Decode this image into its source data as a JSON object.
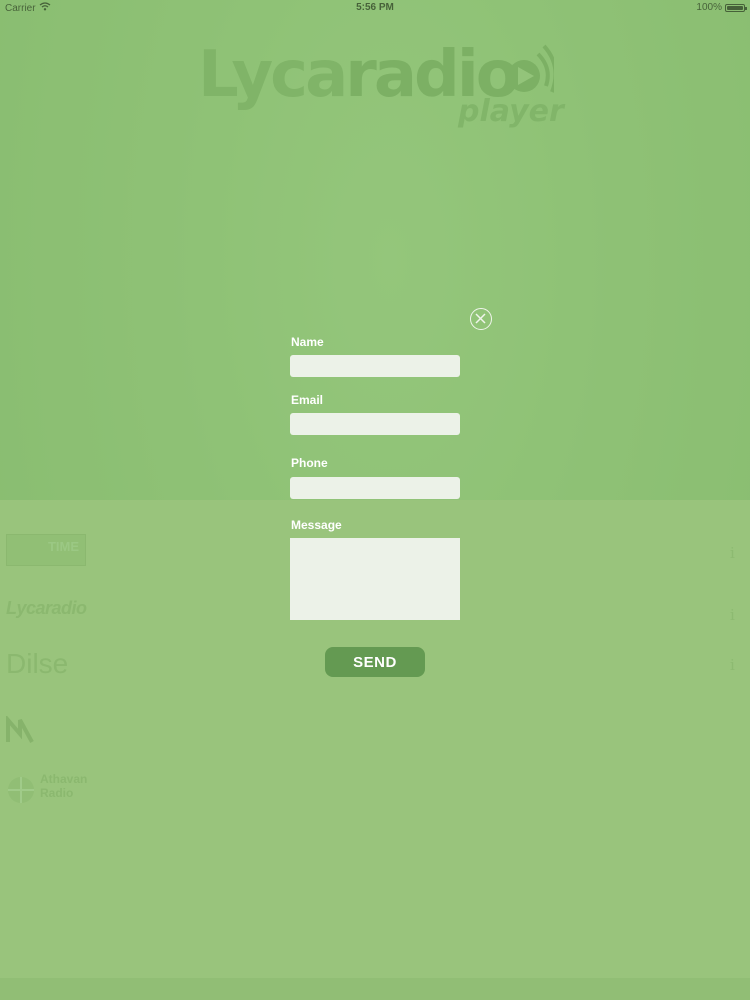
{
  "status_bar": {
    "carrier": "Carrier",
    "time": "5:56 PM",
    "battery": "100%",
    "battery_level": 1.0
  },
  "logo": {
    "word_lyca": "Lyca",
    "word_radio": "radio",
    "sub": "player"
  },
  "stations": [
    {
      "name": "TIME",
      "icon": "time-logo"
    },
    {
      "name": "Lycaradio",
      "icon": "lycaradio-logo"
    },
    {
      "name": "Dilse",
      "icon": "dilse-logo"
    },
    {
      "name": "",
      "icon": "radio-logo"
    },
    {
      "name": "Athavan Radio",
      "icon": "athavan-logo"
    }
  ],
  "form": {
    "name_label": "Name",
    "name_value": "",
    "email_label": "Email",
    "email_value": "",
    "phone_label": "Phone",
    "phone_value": "",
    "message_label": "Message",
    "message_value": "",
    "send_label": "SEND"
  },
  "colors": {
    "background": "#8abd73",
    "button": "#649a52",
    "field": "#ecf2e8"
  }
}
